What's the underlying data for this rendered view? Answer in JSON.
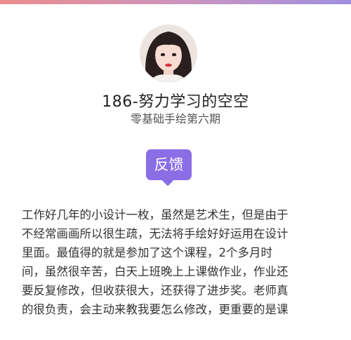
{
  "profile": {
    "name": "186-努力学习的空空",
    "course": "零基础手绘第六期",
    "avatar_icon": "user-portrait"
  },
  "section": {
    "tag_label": "反馈",
    "tag_color": "#8b6de6"
  },
  "feedback": {
    "lines": [
      "工作好几年的小设计一枚，虽然是艺术生，但是由于",
      "不经常画画所以很生疏，无法将手绘好好运用在设计",
      "里面。最值得的就是参加了这个课程，2个多月时",
      "间，虽然很辛苦，白天上班晚上上课做作业，作业还",
      "要反复修改，但收获很大，还获得了进步奖。老师真",
      "的很负责，会主动来教我要怎么修改，更重要的是课"
    ]
  }
}
